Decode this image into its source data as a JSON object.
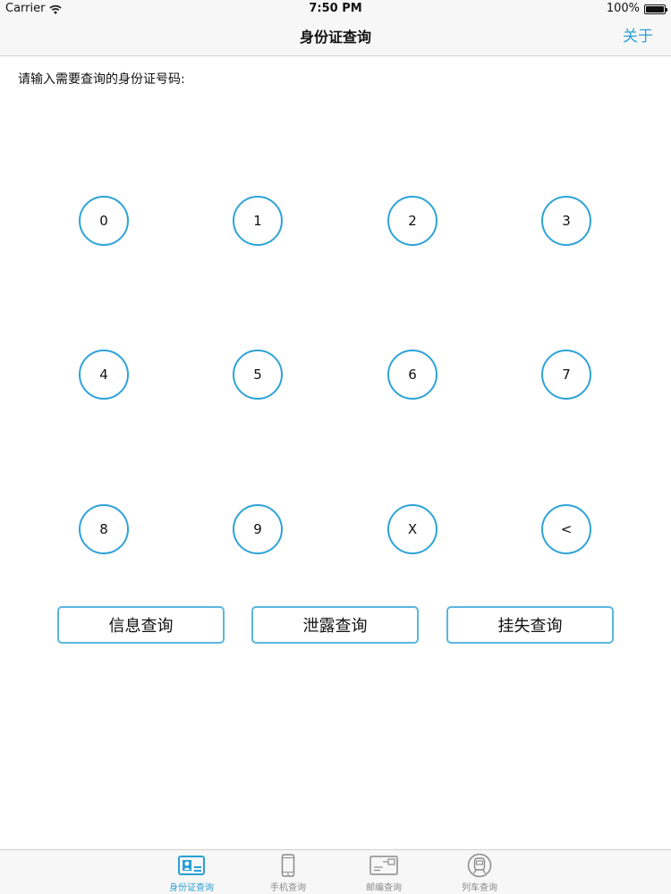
{
  "colors": {
    "accent": "#2a9fd6",
    "key_border": "#2ea3d8",
    "inactive_tab": "#8a8a8a"
  },
  "status_bar": {
    "carrier": "Carrier",
    "time": "7:50 PM",
    "battery": "100%"
  },
  "nav": {
    "title": "身份证查询",
    "about": "关于"
  },
  "prompt": "请输入需要查询的身份证号码:",
  "keypad": {
    "keys": [
      "0",
      "1",
      "2",
      "3",
      "4",
      "5",
      "6",
      "7",
      "8",
      "9",
      "X",
      "<"
    ]
  },
  "actions": [
    {
      "label": "信息查询"
    },
    {
      "label": "泄露查询"
    },
    {
      "label": "挂失查询"
    }
  ],
  "tabs": [
    {
      "label": "身份证查询",
      "icon": "id-card-icon",
      "active": true
    },
    {
      "label": "手机查询",
      "icon": "phone-icon",
      "active": false
    },
    {
      "label": "邮编查询",
      "icon": "postcard-icon",
      "active": false
    },
    {
      "label": "列车查询",
      "icon": "train-icon",
      "active": false
    }
  ]
}
